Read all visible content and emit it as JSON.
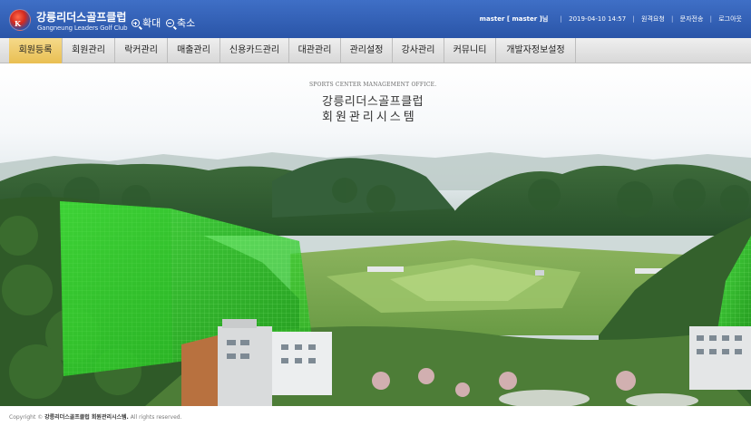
{
  "header": {
    "brand_kr": "강릉리더스골프클럽",
    "brand_en": "Gangneung Leaders Golf Club",
    "logo_letter": "K",
    "zoom_in_label": "확대",
    "zoom_out_label": "축소",
    "user_text": "master [ master ]님",
    "datetime": "2019-04-10 14:57",
    "links": [
      "원격요청",
      "문자전송",
      "로그아웃"
    ],
    "separator": "|"
  },
  "menu": {
    "items": [
      {
        "label": "회원등록",
        "active": true
      },
      {
        "label": "회원관리",
        "active": false
      },
      {
        "label": "락커관리",
        "active": false
      },
      {
        "label": "매출관리",
        "active": false
      },
      {
        "label": "신용카드관리",
        "active": false
      },
      {
        "label": "대관관리",
        "active": false
      },
      {
        "label": "관리설정",
        "active": false
      },
      {
        "label": "강사관리",
        "active": false
      },
      {
        "label": "커뮤니티",
        "active": false
      },
      {
        "label": "개발자정보설정",
        "active": false
      }
    ]
  },
  "hero": {
    "eyebrow": "SPORTS CENTER MANAGEMENT OFFICE.",
    "title_line1": "강릉리더스골프클럽",
    "title_line2": "회원관리시스템"
  },
  "footer": {
    "prefix": "Copyright © ",
    "site": "강릉리더스골프클럽 회원관리시스템.",
    "suffix": " All rights reserved."
  },
  "colors": {
    "header_blue": "#2f5db3",
    "menu_active": "#e9bf52",
    "net_green": "#33d12e"
  }
}
